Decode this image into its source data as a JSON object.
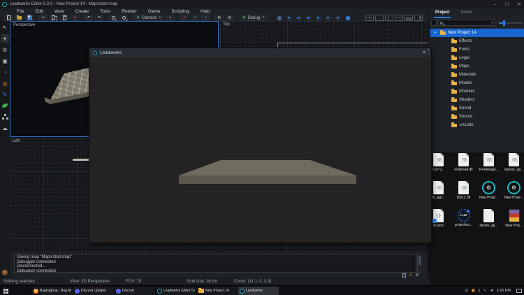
{
  "colors": {
    "accent": "#2f7fe0",
    "selection": "#1866d1",
    "folder": "#e9b13e",
    "teal": "#19b9c3",
    "warning": "#e0922f",
    "platform-top": "#6f6b5f",
    "platform-front": "#5c584e"
  },
  "window": {
    "title": "Leadwerks Editor 5.0.0 - New Project 14 - Maps/start.map",
    "controls": {
      "minimize": "–",
      "maximize": "▢",
      "close": "✕"
    }
  },
  "menu": {
    "items": [
      "File",
      "Edit",
      "View",
      "Create",
      "Tools",
      "Render",
      "Game",
      "Scripting",
      "Help"
    ]
  },
  "toolbar": {
    "camera_label": "Camera",
    "debug_label": "Debug",
    "glyphs": {
      "cut": "✂",
      "delete": "✕",
      "undo": "↶",
      "redo": "↷",
      "plus": "+",
      "axis": "↗",
      "gear": "⚙",
      "play": "▶",
      "caret": "▾"
    },
    "render_modes": [
      {
        "state": "solid"
      },
      {
        "state": "dot"
      },
      {
        "state": "dot"
      },
      {
        "state": "dot"
      },
      {
        "state": "dot"
      },
      {
        "state": "dot"
      },
      {
        "state": "dot"
      },
      {
        "state": "bright"
      }
    ],
    "layouts": [
      {
        "type": "quad"
      },
      {
        "type": "single"
      },
      {
        "type": "vsplit"
      },
      {
        "type": "hsplit"
      },
      {
        "type": "bottom"
      },
      {
        "type": "right"
      }
    ]
  },
  "viewports": {
    "perspective_label": "Perspective",
    "top_label": "Top",
    "left_label": "Left"
  },
  "dialog": {
    "title": "Leadwerks",
    "close_glyph": "✕"
  },
  "project_panel": {
    "tabs": [
      {
        "label": "Project",
        "state": "active"
      },
      {
        "label": "Scene",
        "state": ""
      }
    ],
    "root": {
      "label": "New Project 14",
      "arrow": "▾"
    },
    "folders": [
      {
        "label": "Effects"
      },
      {
        "label": "Fonts"
      },
      {
        "label": "Legal"
      },
      {
        "label": "Maps"
      },
      {
        "label": "Materials"
      },
      {
        "label": "Models"
      },
      {
        "label": "Modules"
      },
      {
        "label": "Shaders"
      },
      {
        "label": "Sound"
      },
      {
        "label": "Source"
      },
      {
        "label": ".vscode"
      }
    ],
    "collapse_glyph": "‹"
  },
  "console": {
    "lines": [
      "Saving map \"Maps/start.map\"",
      "Debugger connected",
      "Disconnected...",
      "Debugger connected"
    ]
  },
  "status": {
    "items": [
      "Nothing selected",
      "View: 3D Perspective",
      "FOV: 70",
      "Grid size: 16 cm",
      "Coord: (11.1, 0, 3.3)"
    ]
  },
  "desktop": {
    "icons": [
      {
        "label": "n in V...",
        "type": "dll"
      },
      {
        "label": "embree4.dll",
        "type": "dll"
      },
      {
        "label": "FreeImage...",
        "type": "dll"
      },
      {
        "label": "openvr_ap...",
        "type": "dll"
      },
      {
        "label": "m_api...",
        "type": "dll"
      },
      {
        "label": "tbb12.dll",
        "type": "dll"
      },
      {
        "label": "New Proje...",
        "type": "lw"
      },
      {
        "label": "New Proje...",
        "type": "lw"
      },
      {
        "label": "ts.json",
        "type": "json"
      },
      {
        "label": "projectico...",
        "type": "lua"
      },
      {
        "label": "steam_ap...",
        "type": "page"
      },
      {
        "label": "New Proj...",
        "type": "winrar"
      }
    ]
  },
  "taskbar": {
    "apps": [
      {
        "label": "Bugbugbug - Bug Re...",
        "icon": "firefox",
        "state": ""
      },
      {
        "label": "Discord Updater",
        "icon": "discord",
        "state": ""
      },
      {
        "label": "Discord",
        "icon": "discord",
        "state": ""
      },
      {
        "label": "Leadwerks Editor 5.0...",
        "icon": "leadwerks",
        "state": ""
      },
      {
        "label": "New Project 14",
        "icon": "folderic",
        "state": ""
      },
      {
        "label": "Leadwerks",
        "icon": "leadwerks",
        "state": "active"
      }
    ],
    "time": "3:26 PM"
  }
}
